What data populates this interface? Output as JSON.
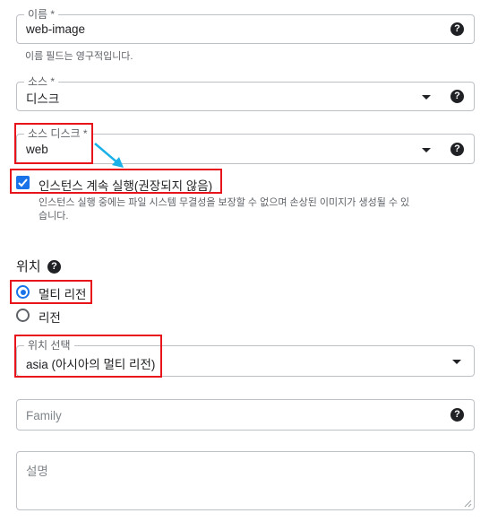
{
  "name_field": {
    "label": "이름 *",
    "value": "web-image",
    "hint": "이름 필드는 영구적입니다.",
    "help_icon": "help-circle-icon"
  },
  "source_field": {
    "label": "소스 *",
    "value": "디스크",
    "arrow_icon": "dropdown-arrow-icon",
    "help_icon": "help-circle-icon"
  },
  "source_disk_field": {
    "label": "소스 디스크 *",
    "value": "web",
    "arrow_icon": "dropdown-arrow-icon",
    "help_icon": "help-circle-icon"
  },
  "keep_instance_checkbox": {
    "label": "인스턴스 계속 실행(권장되지 않음)",
    "checked": true,
    "hint_line1": "인스턴스 실행 중에는 파일 시스템 무결성을 보장할 수 없으며 손상된 이미지가 생성될 수 있",
    "hint_line2": "습니다."
  },
  "location_section": {
    "title": "위치",
    "help_icon": "help-circle-icon",
    "options": [
      {
        "label": "멀티 리전",
        "selected": true
      },
      {
        "label": "리전",
        "selected": false
      }
    ]
  },
  "location_select": {
    "label": "위치 선택",
    "value": "asia (아시아의 멀티 리전)",
    "arrow_icon": "dropdown-arrow-icon"
  },
  "family_field": {
    "placeholder": "Family",
    "help_icon": "help-circle-icon"
  },
  "description_field": {
    "placeholder": "설명"
  },
  "annotation": {
    "highlight_color": "#e8141b",
    "arrow_color": "#1ab1e8"
  }
}
